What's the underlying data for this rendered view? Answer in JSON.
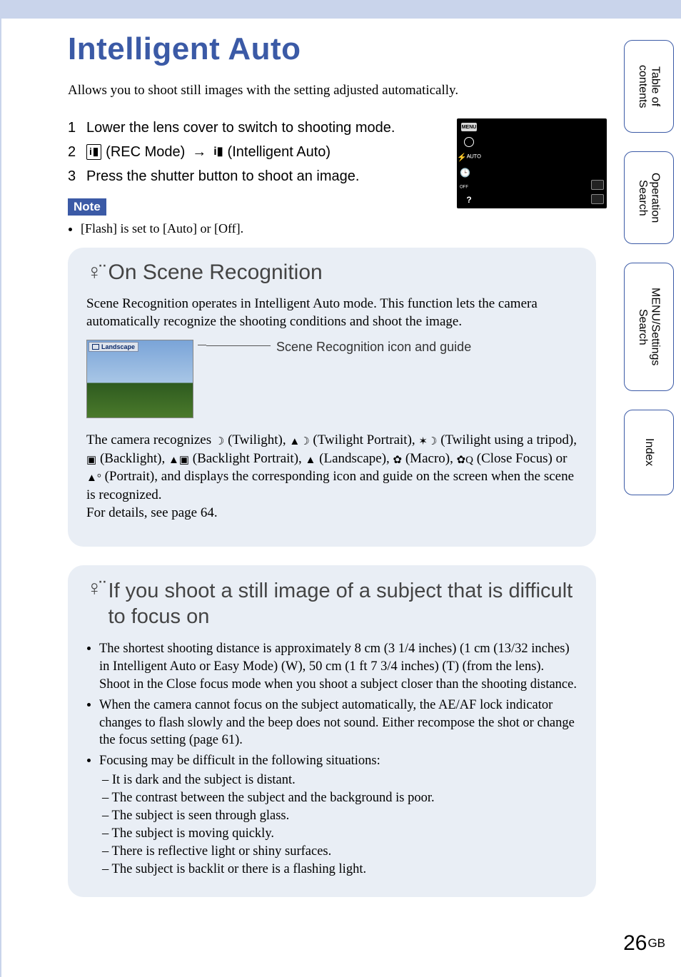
{
  "title": "Intelligent Auto",
  "intro": "Allows you to shoot still images with the setting adjusted automatically.",
  "steps": {
    "s1_num": "1",
    "s1": "Lower the lens cover to switch to shooting mode.",
    "s2_num": "2",
    "s2_rec": " (REC Mode) ",
    "s2_arrow": "→",
    "s2_int": " (Intelligent Auto)",
    "s3_num": "3",
    "s3": "Press the shutter button to shoot an image."
  },
  "cam_preview": {
    "menu": "MENU",
    "flash": "⚡ᴬᵁᵀᴼ",
    "timer_sub": "OFF",
    "q": "?"
  },
  "note": {
    "label": "Note",
    "item": "[Flash] is set to [Auto] or [Off]."
  },
  "panel1": {
    "title": "On Scene Recognition",
    "para": "Scene Recognition operates in Intelligent Auto mode. This function lets the camera automatically recognize the shooting conditions and shoot the image.",
    "thumb_label": "Landscape",
    "caption": "Scene Recognition icon and guide",
    "rec_line1a": "The camera recognizes ",
    "rec_twilight": " (Twilight), ",
    "rec_twilight_portrait": " (Twilight Portrait), ",
    "rec_tripod": " (Twilight using a tripod),",
    "rec_backlight": " (Backlight), ",
    "rec_backlight_portrait": " (Backlight Portrait), ",
    "rec_landscape": " (Landscape), ",
    "rec_macro": " (Macro), ",
    "rec_close": " (Close Focus) or",
    "rec_portrait": " (Portrait), and displays the corresponding icon and guide on the screen when the scene is recognized.",
    "details": "For details, see page 64."
  },
  "panel2": {
    "title": "If you shoot a still image of a subject that is difficult to focus on",
    "b1": "The shortest shooting distance is approximately 8 cm (3 1/4 inches) (1 cm (13/32 inches) in Intelligent Auto or Easy Mode) (W), 50 cm (1 ft 7 3/4 inches) (T) (from the lens). Shoot in the Close focus mode when you shoot a subject closer than the shooting distance.",
    "b2": "When the camera cannot focus on the subject automatically, the AE/AF lock indicator changes to flash slowly and the beep does not sound. Either recompose the shot or change the focus setting (page 61).",
    "b3": "Focusing may be difficult in the following situations:",
    "s1": "– It is dark and the subject is distant.",
    "s2": "– The contrast between the subject and the background is poor.",
    "s3": "– The subject is seen through glass.",
    "s4": "– The subject is moving quickly.",
    "s5": "– There is reflective light or shiny surfaces.",
    "s6": "– The subject is backlit or there is a flashing light."
  },
  "sidetabs": {
    "toc": "Table of contents",
    "op": "Operation Search",
    "menu": "MENU/Settings Search",
    "index": "Index"
  },
  "page_num": "26",
  "page_suffix": "GB"
}
